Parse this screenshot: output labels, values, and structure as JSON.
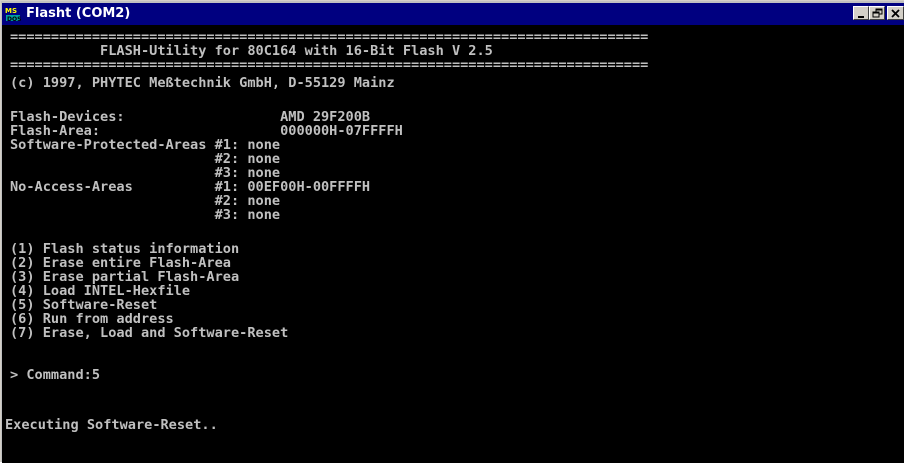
{
  "window": {
    "title": "Flasht (COM2)",
    "icon": "ms-dos-icon",
    "buttons": [
      "minimize",
      "maximize",
      "close"
    ]
  },
  "console": {
    "lines": [
      "==============================================================================",
      "           FLASH-Utility for 80C164 with 16-Bit Flash V 2.5",
      "==============================================================================",
      "(c) 1997, PHYTEC Meßtechnik GmbH, D-55129 Mainz",
      "",
      "Flash-Devices:                   AMD 29F200B",
      "Flash-Area:                      000000H-07FFFFH",
      "Software-Protected-Areas #1: none",
      "                         #2: none",
      "                         #3: none",
      "No-Access-Areas          #1: 00EF00H-00FFFFH",
      "                         #2: none",
      "                         #3: none",
      "",
      "(1) Flash status information",
      "(2) Erase entire Flash-Area",
      "(3) Erase partial Flash-Area",
      "(4) Load INTEL-Hexfile",
      "(5) Software-Reset",
      "(6) Run from address",
      "(7) Erase, Load and Software-Reset",
      "",
      "> Command:5",
      "",
      "Executing Software-Reset.."
    ]
  }
}
